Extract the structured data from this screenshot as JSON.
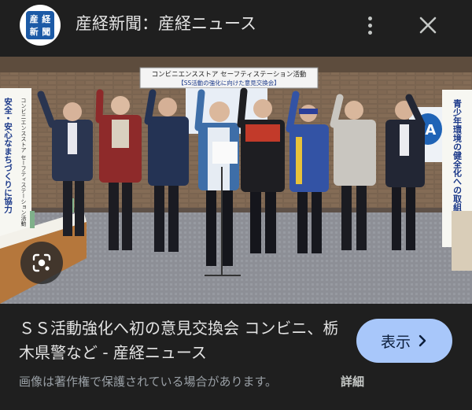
{
  "header": {
    "logo_chars": [
      "産",
      "経",
      "新",
      "聞"
    ],
    "source_title": "産経新聞：産経ニュース",
    "more_icon": "more-vert-icon",
    "close_icon": "close-icon"
  },
  "photo": {
    "banner_line1": "コンビニエンスストア セーフティステーション活動",
    "banner_line2": "【SS活動の強化に向けた意見交換会】",
    "left_banner": "安全・安心なまちづくりに協力",
    "left_banner_small": "コンビニエンスストア セーフティステーション活動",
    "right_banner": "青少年環境の健全化への取組み",
    "lens_icon": "google-lens-icon"
  },
  "caption": {
    "title": "ＳＳ活動強化へ初の意見交換会 コンビニ、栃木県警など - 産経ニュース"
  },
  "view_button": {
    "label": "表示",
    "icon": "chevron-right-icon"
  },
  "footer": {
    "notice": "画像は著作権で保護されている場合があります。",
    "details_label": "詳細"
  },
  "colors": {
    "background": "#1f1f1f",
    "button": "#a8c7fa",
    "text": "#e3e3e3",
    "muted": "#9aa0a6"
  }
}
